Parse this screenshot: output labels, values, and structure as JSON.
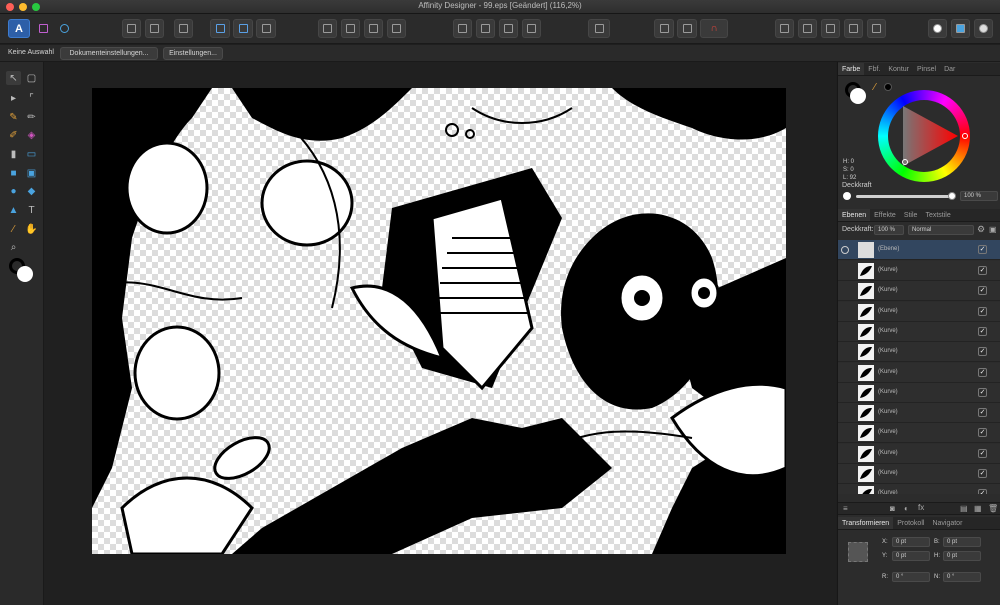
{
  "window": {
    "title": "Affinity Designer - 99.eps [Geändert] (116,2%)"
  },
  "context_toolbar": {
    "selection": "Keine Auswahl",
    "document_settings": "Dokumenteinstellungen...",
    "preferences": "Einstellungen..."
  },
  "color_panel": {
    "tabs": [
      "Farbe",
      "Fbf.",
      "Kontur",
      "Pinsel",
      "Dar"
    ],
    "h": "H: 0",
    "s": "S: 0",
    "l": "L: 92",
    "opacity_label": "Deckkraft",
    "opacity_value": "100 %"
  },
  "layers_panel": {
    "tabs": [
      "Ebenen",
      "Effekte",
      "Stile",
      "Textstile"
    ],
    "opacity_label": "Deckkraft:",
    "opacity_value": "100 %",
    "blend_mode": "Normal",
    "root_layer": "(Ebene)",
    "curve_label": "(Kurve)",
    "curve_count": 12
  },
  "transform_panel": {
    "tabs": [
      "Transformieren",
      "Protokoll",
      "Navigator"
    ],
    "x_label": "X:",
    "x_value": "0 pt",
    "y_label": "Y:",
    "y_value": "0 pt",
    "b_label": "B:",
    "b_value": "0 pt",
    "h_label": "H:",
    "h_value": "0 pt",
    "r_label": "R:",
    "r_value": "0 °",
    "n_label": "N:",
    "n_value": "0 °"
  },
  "colors": {
    "accent": "#3d7ccf",
    "close": "#fe5f57",
    "minimize": "#febc2e",
    "zoom": "#28c840",
    "stroke": "#000000",
    "fill": "#ffffff"
  }
}
